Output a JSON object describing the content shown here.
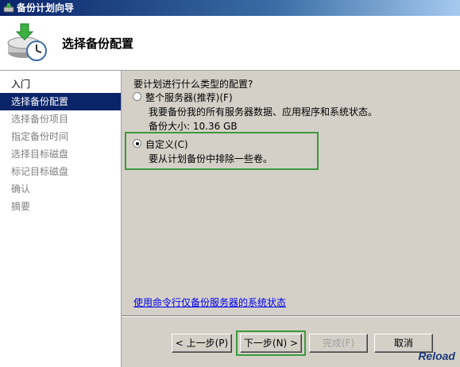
{
  "window": {
    "title": "备份计划向导"
  },
  "header": {
    "title": "选择备份配置"
  },
  "nav": {
    "items": [
      {
        "label": "入门",
        "state": "done"
      },
      {
        "label": "选择备份配置",
        "state": "active"
      },
      {
        "label": "选择备份项目",
        "state": "pending"
      },
      {
        "label": "指定备份时间",
        "state": "pending"
      },
      {
        "label": "选择目标磁盘",
        "state": "pending"
      },
      {
        "label": "标记目标磁盘",
        "state": "pending"
      },
      {
        "label": "确认",
        "state": "pending"
      },
      {
        "label": "摘要",
        "state": "pending"
      }
    ]
  },
  "main": {
    "prompt": "要计划进行什么类型的配置?",
    "options": [
      {
        "label": "整个服务器(推荐)(F)",
        "desc": "我要备份我的所有服务器数据、应用程序和系统状态。",
        "size_text": "备份大小: 10.36 GB",
        "selected": false
      },
      {
        "label": "自定义(C)",
        "desc": "要从计划备份中排除一些卷。",
        "selected": true
      }
    ],
    "link": "使用命令行仅备份服务器的系统状态"
  },
  "buttons": {
    "back": "< 上一步(P)",
    "next": "下一步(N) >",
    "finish": "完成(F)",
    "cancel": "取消"
  },
  "watermark": "Reload",
  "colors": {
    "nav_active": "#0a246a",
    "highlight": "#3c9a3c",
    "link": "#0000ee"
  }
}
